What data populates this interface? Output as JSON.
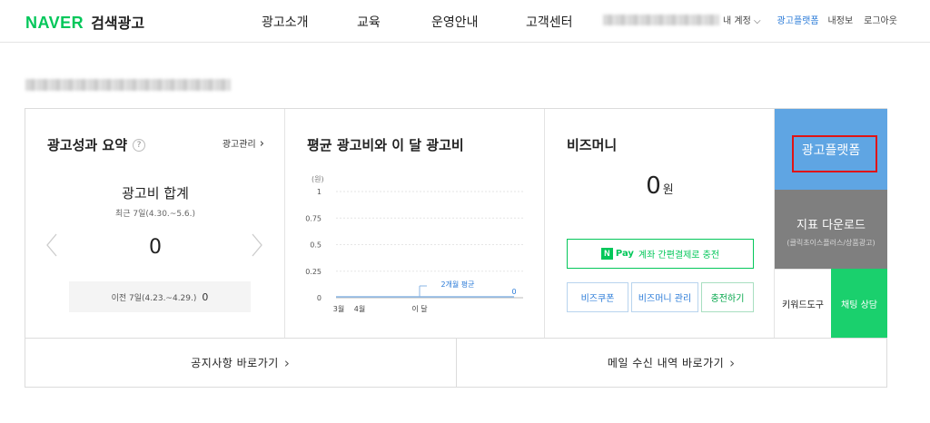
{
  "header": {
    "brand": "NAVER",
    "service": "검색광고",
    "nav": [
      "광고소개",
      "교육",
      "운영안내",
      "고객센터"
    ],
    "account_suffix": "내 계정",
    "ad_platform_link": "광고플랫폼",
    "my_info": "내정보",
    "logout": "로그아웃",
    "brand_color": "#03c75a"
  },
  "summary": {
    "title": "광고성과 요약",
    "help": "?",
    "manage_link": "광고관리",
    "metric_label": "광고비 합계",
    "period": "최근 7일(4.30.~5.6.)",
    "value": "0",
    "prev_label": "이전 7일(4.23.~4.29.)",
    "prev_value": "0"
  },
  "avg_cost": {
    "title": "평균 광고비와 이 달 광고비",
    "chart_data": {
      "type": "line",
      "unit_label": "(원)",
      "y_ticks": [
        "1",
        "0.75",
        "0.5",
        "0.25",
        "0"
      ],
      "ylim": [
        0,
        1
      ],
      "categories": [
        "3월",
        "4월",
        "이 달"
      ],
      "series": [
        {
          "name": "2개월 평균",
          "values": [
            0,
            0
          ]
        },
        {
          "name": "",
          "values": [
            0
          ]
        }
      ],
      "annotations": [
        {
          "text": "2개월 평균"
        },
        {
          "text": "0"
        }
      ]
    }
  },
  "bizmoney": {
    "title": "비즈머니",
    "value": "0",
    "unit": "원",
    "pay_brand": "Pay",
    "pay_button": "계좌 간편결제로 충전",
    "buttons": [
      "비즈쿠폰",
      "비즈머니 관리",
      "충전하기"
    ]
  },
  "side": {
    "ad_platform": "광고플랫폼",
    "report_download": "지표 다운로드",
    "report_sub": "(클릭초이스플러스/상품광고)",
    "keyword_tool": "키워드도구",
    "chat": "채팅 상담",
    "colors": {
      "platform": "#5fa5e3",
      "report": "#7f7f7f",
      "chat": "#1ad06d",
      "highlight": "#e01414"
    }
  },
  "bottom_links": [
    "공지사항 바로가기",
    "메일 수신 내역 바로가기"
  ]
}
